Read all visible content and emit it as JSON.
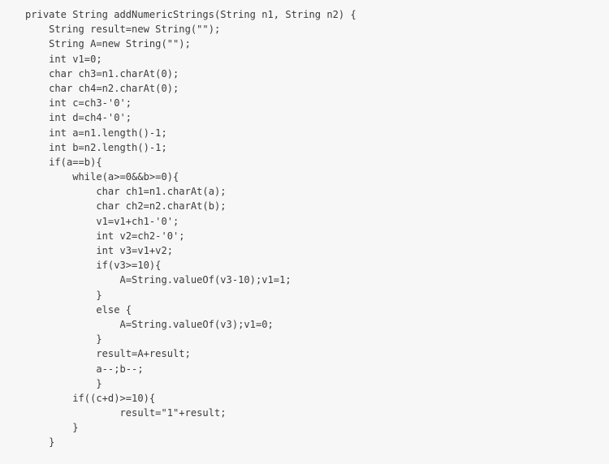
{
  "editor": {
    "background_color": "#f7f7f7",
    "text_color": "#3b3b3b",
    "language": "Java",
    "indent_unit": "    "
  },
  "code": {
    "lines": [
      "private String addNumericStrings(String n1, String n2) {",
      "    String result=new String(\"\");",
      "    String A=new String(\"\");",
      "    int v1=0;",
      "    char ch3=n1.charAt(0);",
      "    char ch4=n2.charAt(0);",
      "    int c=ch3-'0';",
      "    int d=ch4-'0';",
      "    int a=n1.length()-1;",
      "    int b=n2.length()-1;",
      "    if(a==b){",
      "        while(a>=0&&b>=0){",
      "            char ch1=n1.charAt(a);",
      "            char ch2=n2.charAt(b);",
      "            v1=v1+ch1-'0';",
      "            int v2=ch2-'0';",
      "            int v3=v1+v2;",
      "            if(v3>=10){",
      "                A=String.valueOf(v3-10);v1=1;",
      "            }",
      "            else {",
      "                A=String.valueOf(v3);v1=0;",
      "            }",
      "            result=A+result;",
      "            a--;b--;",
      "            }",
      "        if((c+d)>=10){",
      "                result=\"1\"+result;",
      "        }",
      "    }"
    ]
  }
}
